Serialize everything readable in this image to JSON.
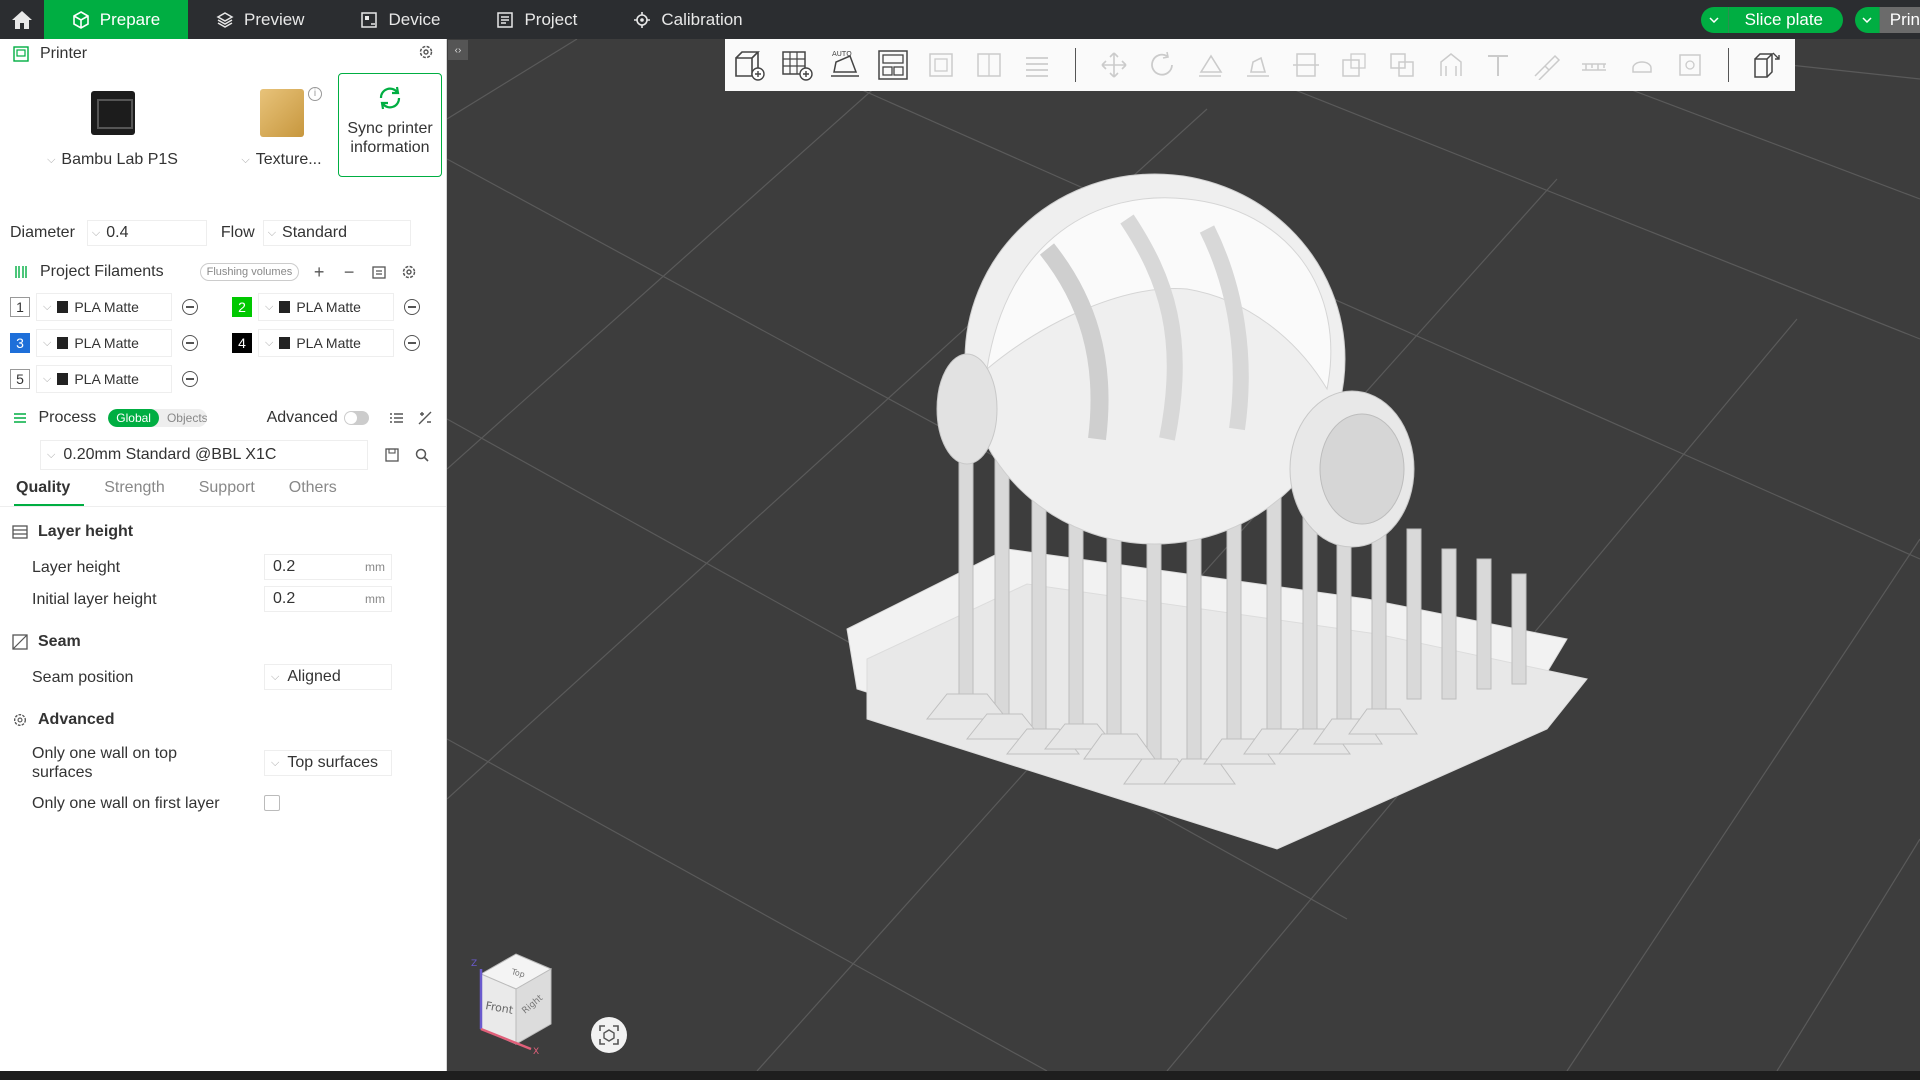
{
  "topbar": {
    "tabs": [
      {
        "label": "Prepare",
        "icon": "cube-icon"
      },
      {
        "label": "Preview",
        "icon": "layers-icon"
      },
      {
        "label": "Device",
        "icon": "device-icon"
      },
      {
        "label": "Project",
        "icon": "project-icon"
      },
      {
        "label": "Calibration",
        "icon": "calibration-icon"
      }
    ],
    "slice_label": "Slice plate",
    "print_label": "Prin"
  },
  "printer": {
    "title": "Printer",
    "model": "Bambu Lab P1S",
    "plate": "Texture...",
    "sync_line1": "Sync printer",
    "sync_line2": "information",
    "diameter_label": "Diameter",
    "diameter_value": "0.4",
    "flow_label": "Flow",
    "flow_value": "Standard"
  },
  "filaments": {
    "title": "Project Filaments",
    "flushing_label": "Flushing volumes",
    "items": [
      {
        "num": "1",
        "name": "PLA Matte",
        "color": "#ffffff",
        "num_color": "#333333"
      },
      {
        "num": "2",
        "name": "PLA Matte",
        "color": "#00c800",
        "num_color": "#ffffff"
      },
      {
        "num": "3",
        "name": "PLA Matte",
        "color": "#1e6fd9",
        "num_color": "#ffffff"
      },
      {
        "num": "4",
        "name": "PLA Matte",
        "color": "#000000",
        "num_color": "#ffffff"
      },
      {
        "num": "5",
        "name": "PLA Matte",
        "color": "#ffffff",
        "num_color": "#333333"
      }
    ]
  },
  "process": {
    "title": "Process",
    "global_label": "Global",
    "objects_label": "Objects",
    "advanced_label": "Advanced",
    "preset": "0.20mm Standard @BBL X1C",
    "tabs": [
      "Quality",
      "Strength",
      "Support",
      "Others"
    ],
    "groups": {
      "layer_height": {
        "title": "Layer height",
        "layer_height_label": "Layer height",
        "layer_height_value": "0.2",
        "initial_label": "Initial layer height",
        "initial_value": "0.2",
        "unit": "mm"
      },
      "seam": {
        "title": "Seam",
        "position_label": "Seam position",
        "position_value": "Aligned"
      },
      "advanced": {
        "title": "Advanced",
        "top_wall_label_1": "Only one wall on top",
        "top_wall_label_2": "surfaces",
        "top_wall_value": "Top surfaces",
        "first_layer_label": "Only one wall on first layer",
        "first_layer_checked": false
      }
    }
  },
  "navcube": {
    "top": "Top",
    "front": "Front",
    "right": "Right",
    "axis_z": "Z",
    "axis_x": "X"
  },
  "colors": {
    "accent": "#00ae42",
    "topbar": "#2b2d30",
    "viewport": "#3d3d3d"
  }
}
